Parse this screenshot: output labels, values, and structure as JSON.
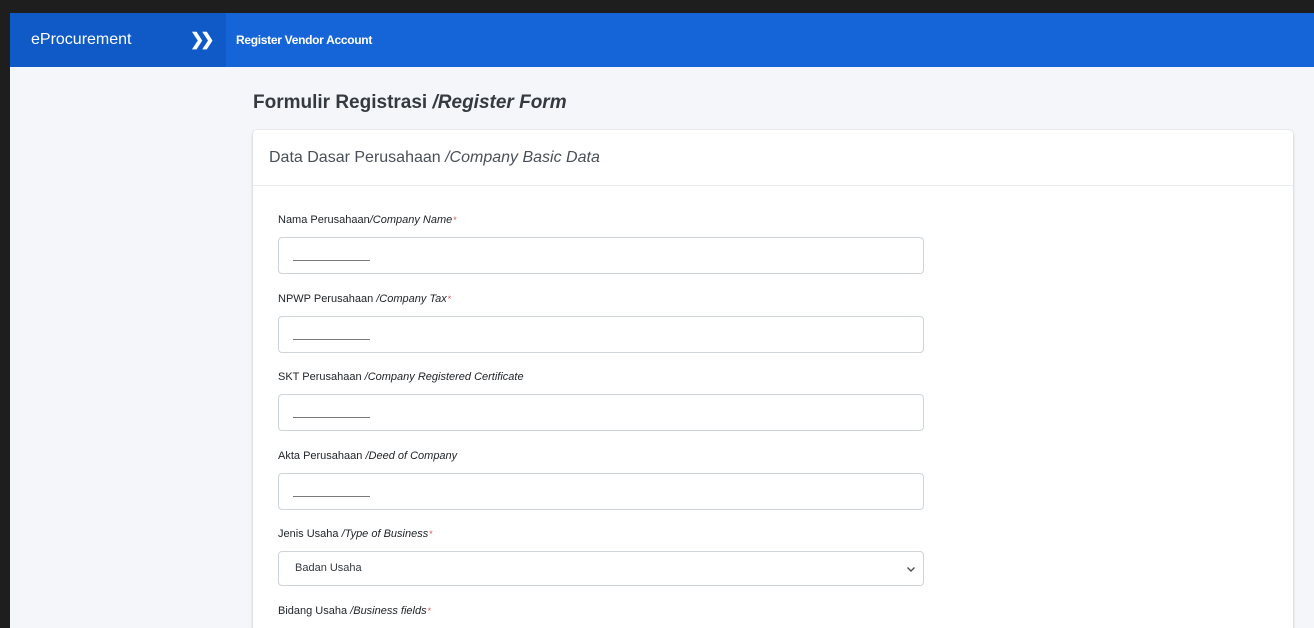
{
  "topbar": {
    "brand": "eProcurement",
    "toggle_icon": "double-chevron-right",
    "page": "Register Vendor Account"
  },
  "page": {
    "title_id": "Formulir Registrasi",
    "title_en": "/Register Form"
  },
  "card": {
    "header_id": "Data Dasar Perusahaan",
    "header_en": "/Company Basic Data"
  },
  "fields": [
    {
      "label_id": "Nama Perusahaan",
      "label_en": "/Company Name",
      "required": "*",
      "value": ""
    },
    {
      "label_id": "NPWP Perusahaan",
      "label_en": "/Company Tax",
      "required": "*",
      "value": ""
    },
    {
      "label_id": "SKT Perusahaan",
      "label_en": "/Company Registered Certificate",
      "required": "",
      "value": ""
    },
    {
      "label_id": "Akta Perusahaan",
      "label_en": "/Deed of Company",
      "required": "",
      "value": ""
    }
  ],
  "business_type": {
    "label_id": "Jenis Usaha",
    "label_en": "/Type of Business",
    "required": "*",
    "selected": "Badan Usaha"
  },
  "business_fields": {
    "label_id": "Bidang Usaha",
    "label_en": "/Business fields",
    "required": "*"
  },
  "colors": {
    "topbar": "#1565d8",
    "brand_bg": "#0f5ac6",
    "required": "#e05757"
  }
}
